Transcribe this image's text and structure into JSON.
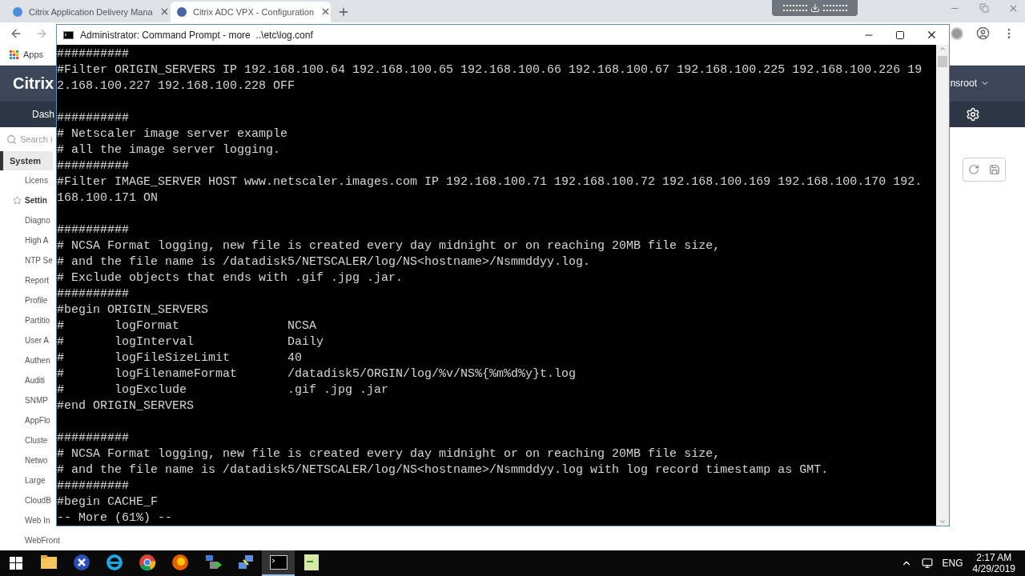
{
  "browser": {
    "tabs": [
      {
        "title": "Citrix Application Delivery Mana",
        "selected": false
      },
      {
        "title": "Citrix ADC VPX - Configuration",
        "selected": true
      }
    ],
    "bookmarks": [
      "Apps"
    ]
  },
  "page": {
    "brand": "Citrix",
    "nav": "Dash",
    "user": "nsroot",
    "search": {
      "placeholder": "Search i"
    },
    "sidebar": {
      "heading": "System",
      "items": [
        {
          "label": "Licens",
          "starred": false
        },
        {
          "label": "Settin",
          "starred": true
        },
        {
          "label": "Diagno",
          "starred": false
        },
        {
          "label": "High A",
          "starred": false
        },
        {
          "label": "NTP Se",
          "starred": false
        },
        {
          "label": "Report",
          "starred": false
        },
        {
          "label": "Profile",
          "starred": false
        },
        {
          "label": "Partitio",
          "starred": false
        },
        {
          "label": "User A",
          "starred": false
        },
        {
          "label": "Authen",
          "starred": false
        },
        {
          "label": "Auditi",
          "starred": false
        },
        {
          "label": "SNMP",
          "starred": false
        },
        {
          "label": "AppFlo",
          "starred": false
        },
        {
          "label": "Cluste",
          "starred": false
        },
        {
          "label": "Netwo",
          "starred": false
        },
        {
          "label": "Large",
          "starred": false
        },
        {
          "label": "CloudB",
          "starred": false
        },
        {
          "label": "Web In",
          "starred": false
        },
        {
          "label": "WebFront",
          "starred": false
        }
      ]
    }
  },
  "console": {
    "title": "Administrator: Command Prompt - more  ..\\etc\\log.conf",
    "blocks": [
      {
        "lines": [
          "##########",
          "#Filter ORIGIN_SERVERS IP 192.168.100.64 192.168.100.65 192.168.100.66 192.168.100.67 192.168.100.225 192.168.100.226 19",
          "2.168.100.227 192.168.100.228 OFF"
        ]
      },
      {
        "lines": [
          "##########",
          "# Netscaler image server example",
          "# all the image server logging.",
          "##########",
          "#Filter IMAGE_SERVER HOST www.netscaler.images.com IP 192.168.100.71 192.168.100.72 192.168.100.169 192.168.100.170 192.",
          "168.100.171 ON"
        ]
      },
      {
        "lines": [
          "##########",
          "# NCSA Format logging, new file is created every day midnight or on reaching 20MB file size,",
          "# and the file name is /datadisk5/NETSCALER/log/NS<hostname>/Nsmmddyy.log.",
          "# Exclude objects that ends with .gif .jpg .jar.",
          "##########",
          "#begin ORIGIN_SERVERS",
          "#       logFormat               NCSA",
          "#       logInterval             Daily",
          "#       logFileSizeLimit        40",
          "#       logFilenameFormat       /datadisk5/ORGIN/log/%v/NS%{%m%d%y}t.log",
          "#       logExclude              .gif .jpg .jar",
          "#end ORIGIN_SERVERS"
        ]
      },
      {
        "lines": [
          "##########",
          "# NCSA Format logging, new file is created every day midnight or on reaching 20MB file size,",
          "# and the file name is /datadisk5/NETSCALER/log/NS<hostname>/Nsmmddyy.log with log record timestamp as GMT.",
          "##########",
          "#begin CACHE_F",
          "-- More (61%) --"
        ]
      }
    ]
  },
  "taskbar": {
    "apps": [
      {
        "kind": "folder",
        "selected": false
      },
      {
        "kind": "xapp",
        "selected": false
      },
      {
        "kind": "ie",
        "selected": false
      },
      {
        "kind": "chrome",
        "selected": false
      },
      {
        "kind": "firefox",
        "selected": false
      },
      {
        "kind": "lock",
        "selected": false
      },
      {
        "kind": "network",
        "selected": false
      },
      {
        "kind": "cmd",
        "selected": true
      },
      {
        "kind": "notepad",
        "selected": false
      }
    ],
    "language": "ENG",
    "time": "2:17 AM",
    "date": "4/29/2019"
  }
}
